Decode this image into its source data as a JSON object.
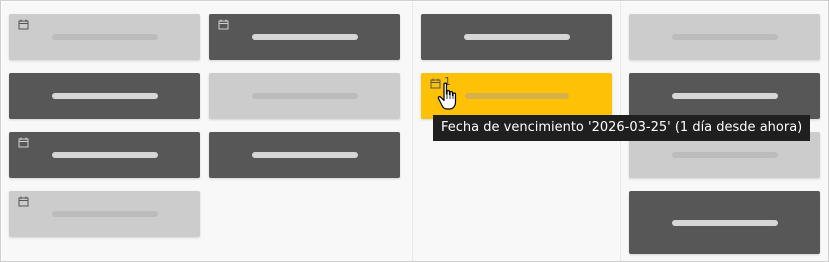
{
  "board": {
    "columns": [
      "col-1",
      "col-2",
      "col-3",
      "col-4"
    ],
    "cards": [
      {
        "id": "c1",
        "column": 1,
        "shade": "light",
        "has_due_date_icon": true
      },
      {
        "id": "c2",
        "column": 1,
        "shade": "dark",
        "has_due_date_icon": false
      },
      {
        "id": "c3",
        "column": 1,
        "shade": "dark",
        "has_due_date_icon": true
      },
      {
        "id": "c4",
        "column": 1,
        "shade": "light",
        "has_due_date_icon": true
      },
      {
        "id": "c5",
        "column": 2,
        "shade": "dark",
        "has_due_date_icon": true
      },
      {
        "id": "c6",
        "column": 2,
        "shade": "light",
        "has_due_date_icon": false
      },
      {
        "id": "c7",
        "column": 2,
        "shade": "dark",
        "has_due_date_icon": false
      },
      {
        "id": "c8",
        "column": 3,
        "shade": "dark",
        "has_due_date_icon": false
      },
      {
        "id": "c9",
        "column": 3,
        "shade": "yellow",
        "has_due_date_icon": true,
        "due_count": "1"
      },
      {
        "id": "c10",
        "column": 4,
        "shade": "light",
        "has_due_date_icon": false
      },
      {
        "id": "c11",
        "column": 4,
        "shade": "dark",
        "has_due_date_icon": false
      },
      {
        "id": "c12",
        "column": 4,
        "shade": "light",
        "has_due_date_icon": false
      },
      {
        "id": "c13",
        "column": 4,
        "shade": "dark",
        "has_due_date_icon": false
      }
    ]
  },
  "highlight_card": {
    "due_count": "1"
  },
  "tooltip": {
    "text": "Fecha de vencimiento '2026-03-25' (1 día desde ahora)"
  },
  "colors": {
    "card_light": "#cccccc",
    "card_dark": "#575757",
    "card_highlight": "#ffc106",
    "tooltip_bg": "#1f1f1f"
  },
  "icons": {
    "due_date": "calendar-icon",
    "cursor": "hand-pointer-icon"
  }
}
